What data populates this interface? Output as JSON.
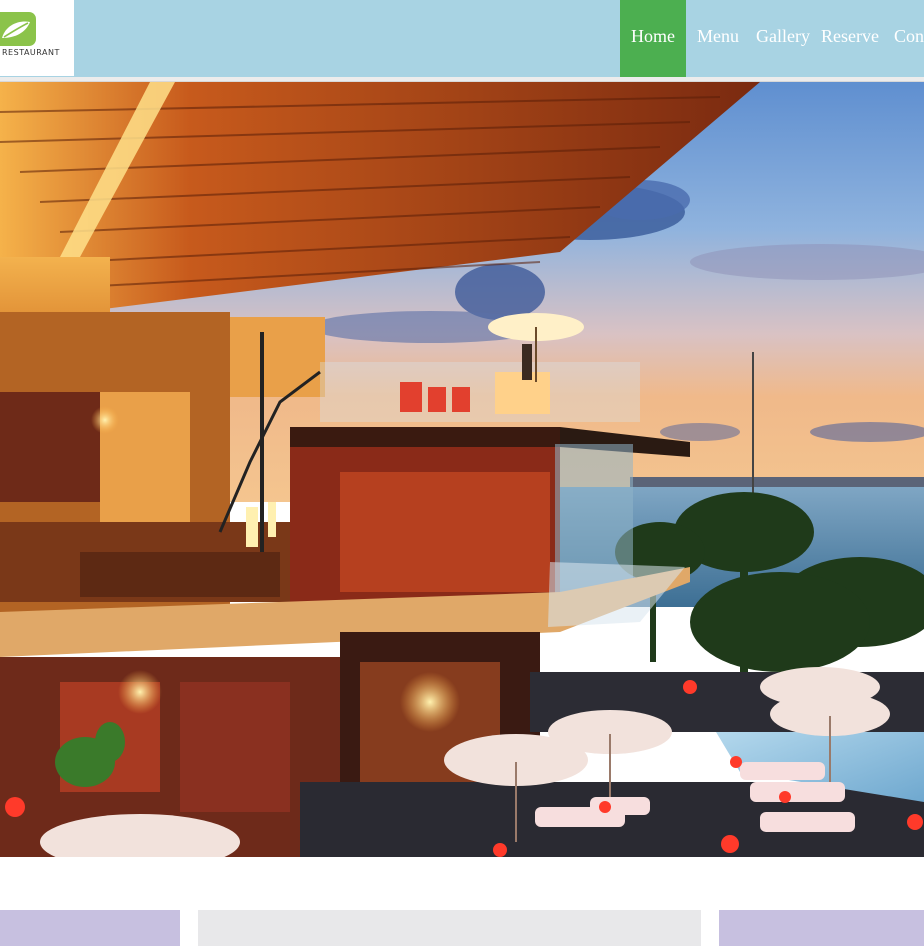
{
  "header": {
    "logo": {
      "icon": "leaf-icon",
      "text": "RESTAURANT"
    },
    "nav": [
      {
        "label": "Home",
        "active": true
      },
      {
        "label": "Menu",
        "active": false
      },
      {
        "label": "Gallery",
        "active": false
      },
      {
        "label": "Reserve",
        "active": false
      },
      {
        "label": "Contact",
        "active": false
      }
    ]
  },
  "hero": {
    "image": "seaside-restaurant-at-sunset-photo"
  },
  "cards": [
    {
      "name": "feature-card-left",
      "color": "#c7c0e0"
    },
    {
      "name": "feature-card-middle",
      "color": "#e8e8ea"
    },
    {
      "name": "feature-card-right",
      "color": "#c7c0e0"
    }
  ],
  "colors": {
    "header_bg": "#a8d3e3",
    "nav_active": "#4caf50",
    "nav_text": "#ffffff"
  }
}
